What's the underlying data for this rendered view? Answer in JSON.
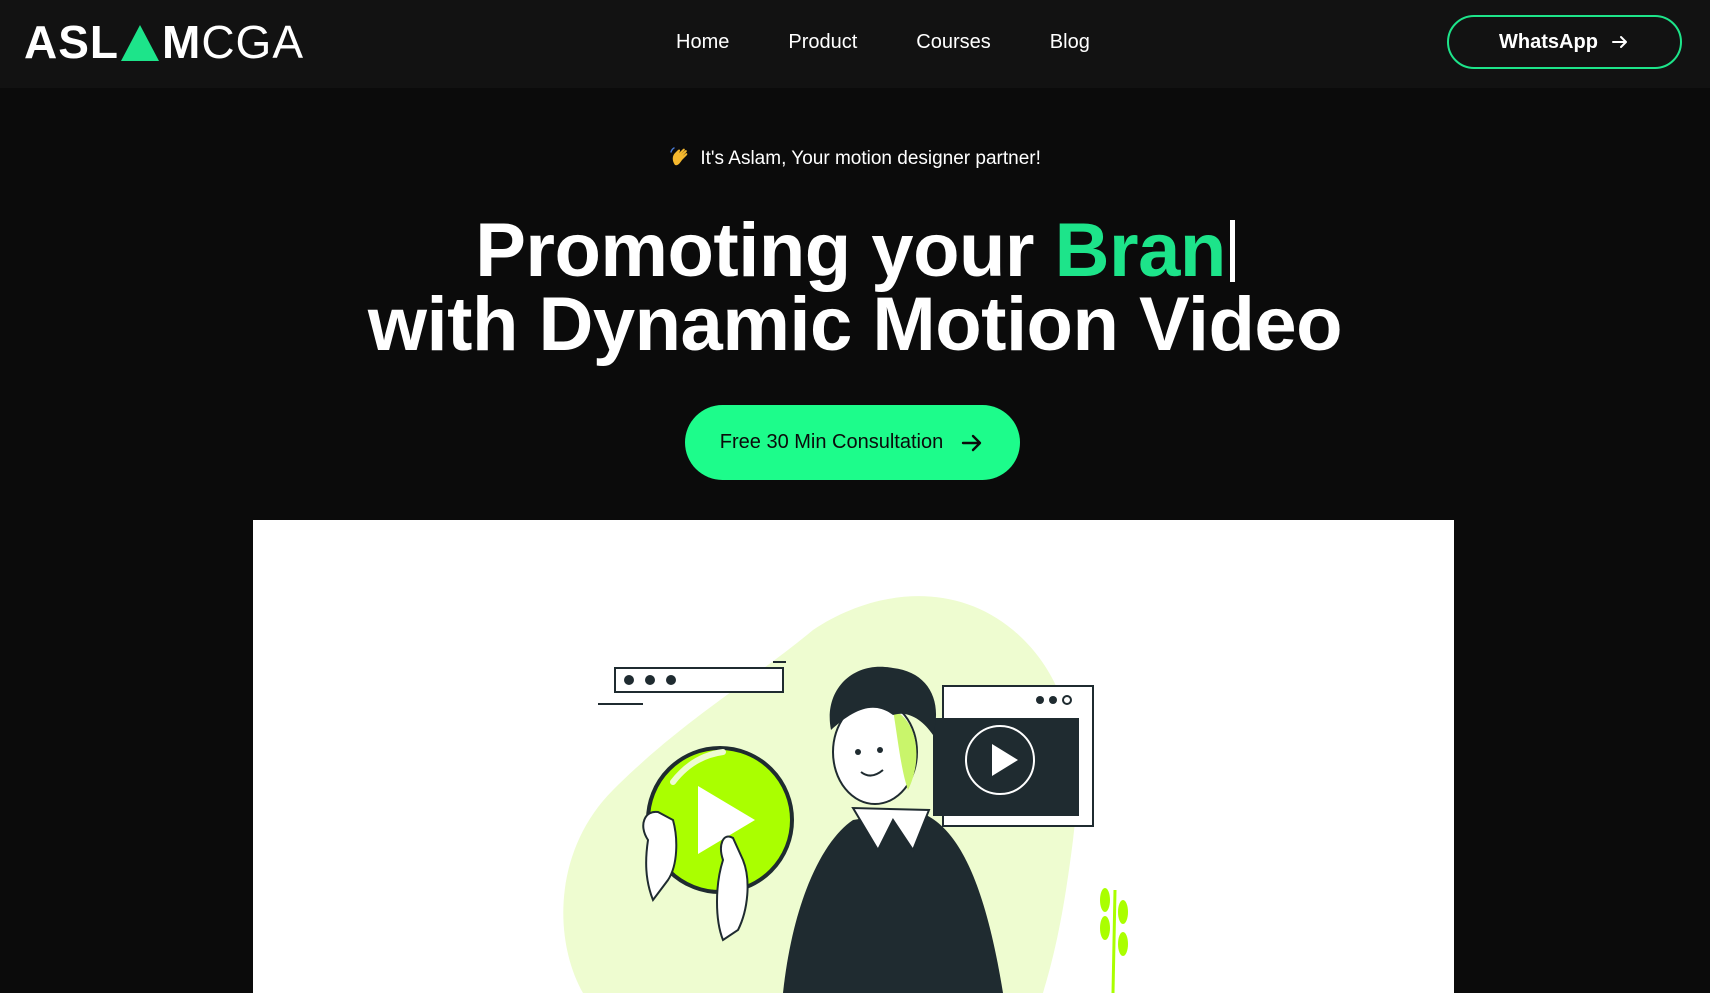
{
  "header": {
    "logo": {
      "part1": "ASL",
      "part2": "M",
      "part3": "CGA"
    },
    "nav": [
      {
        "label": "Home"
      },
      {
        "label": "Product"
      },
      {
        "label": "Courses"
      },
      {
        "label": "Blog"
      }
    ],
    "whatsapp_label": "WhatsApp"
  },
  "hero": {
    "greeting": "It's Aslam, Your motion designer partner!",
    "headline_line1_prefix": "Promoting your ",
    "headline_line1_accent": "Bran",
    "headline_line2": "with Dynamic Motion Video",
    "cta_label": "Free 30 Min Consultation"
  },
  "colors": {
    "accent": "#1de48a",
    "cta_bg": "#1dfc8b",
    "header_bg": "#121212",
    "page_bg": "#0b0b0b",
    "illustration_lime": "#aaff00",
    "illustration_dark": "#1f2b30"
  },
  "icons": {
    "logo_mark": "green-triangle-icon",
    "greeting": "waving-hand-icon",
    "whatsapp_arrow": "arrow-right-icon",
    "cta_arrow": "arrow-right-icon",
    "video_play": "play-icon"
  }
}
